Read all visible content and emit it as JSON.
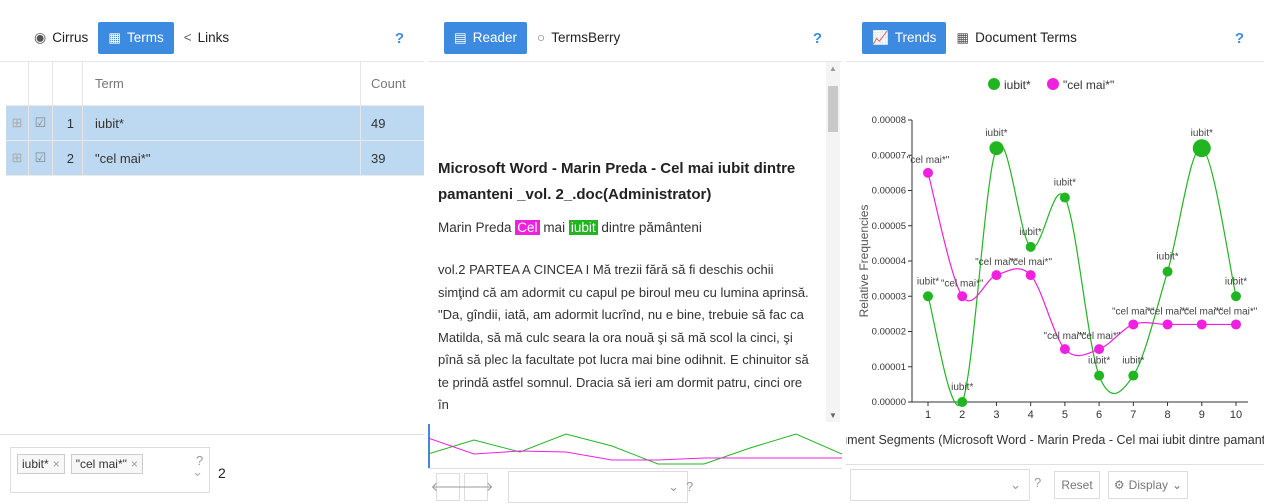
{
  "cirrus_panel": {
    "tabs": [
      {
        "label": "Cirrus",
        "icon": "eye-icon"
      },
      {
        "label": "Terms",
        "icon": "grid-icon"
      },
      {
        "label": "Links",
        "icon": "share-icon"
      }
    ],
    "help": "?",
    "grid": {
      "columns": [
        "Term",
        "Count"
      ],
      "rows": [
        {
          "index": "1",
          "term": "iubit*",
          "count": "49"
        },
        {
          "index": "2",
          "term": "\"cel mai*\"",
          "count": "39"
        }
      ]
    },
    "bottom": {
      "tags": [
        "iubit*",
        "\"cel mai*\""
      ],
      "help": "?",
      "count": "2"
    }
  },
  "reader_panel": {
    "tabs": [
      {
        "label": "Reader",
        "icon": "document-icon"
      },
      {
        "label": "TermsBerry",
        "icon": "circle-icon"
      }
    ],
    "help": "?",
    "title": "Microsoft Word - Marin Preda - Cel mai iubit dintre pamanteni _vol. 2_.doc(Administrator)",
    "subtitle": {
      "before": "Marin Preda ",
      "hl1": "Cel",
      "mid": " mai ",
      "hl2": "iubit",
      "after": " dintre pământeni"
    },
    "text": "vol.2 PARTEA A CINCEA I Mă trezii fără să fi deschis ochii simţind că am adormit cu capul pe biroul meu cu lumina aprinsă. \"Da, gîndii, iată, am adormit lucrînd, nu e bine, trebuie să fac ca Matilda, să mă culc seara la ora nouă şi să mă scol la cinci, şi pînă să plec la facultate pot lucra mai bine odihnit. E chinuitor să te prindă astfel somnul. Dracia să ieri am dormit patru, cinci ore în",
    "bottom_help": "?"
  },
  "trends_panel": {
    "tabs": [
      {
        "label": "Trends",
        "icon": "line-chart-icon"
      },
      {
        "label": "Document Terms",
        "icon": "table-icon"
      }
    ],
    "help": "?",
    "bottom": {
      "help": "?",
      "reset": "Reset",
      "display": "Display"
    }
  },
  "chart_data": {
    "type": "line",
    "title": "",
    "xlabel": "Document Segments (Microsoft Word - Marin Preda - Cel mai iubit dintre pamanteni",
    "ylabel": "Relative Frequencies",
    "x": [
      1,
      2,
      3,
      4,
      5,
      6,
      7,
      8,
      9,
      10
    ],
    "ylim": [
      0,
      8e-05
    ],
    "yticks": [
      "0.00000",
      "0.00001",
      "0.00002",
      "0.00003",
      "0.00004",
      "0.00005",
      "0.00006",
      "0.00007",
      "0.00008"
    ],
    "legend_position": "top",
    "series": [
      {
        "name": "iubit*",
        "color": "#22b522",
        "values": [
          3e-05,
          0.0,
          7.2e-05,
          4.4e-05,
          5.8e-05,
          7.5e-06,
          7.5e-06,
          3.7e-05,
          7.2e-05,
          3e-05
        ]
      },
      {
        "name": "\"cel mai*\"",
        "color": "#f020e0",
        "values": [
          6.5e-05,
          3e-05,
          3.6e-05,
          3.6e-05,
          1.5e-05,
          1.5e-05,
          2.2e-05,
          2.2e-05,
          2.2e-05,
          2.2e-05
        ]
      }
    ]
  }
}
